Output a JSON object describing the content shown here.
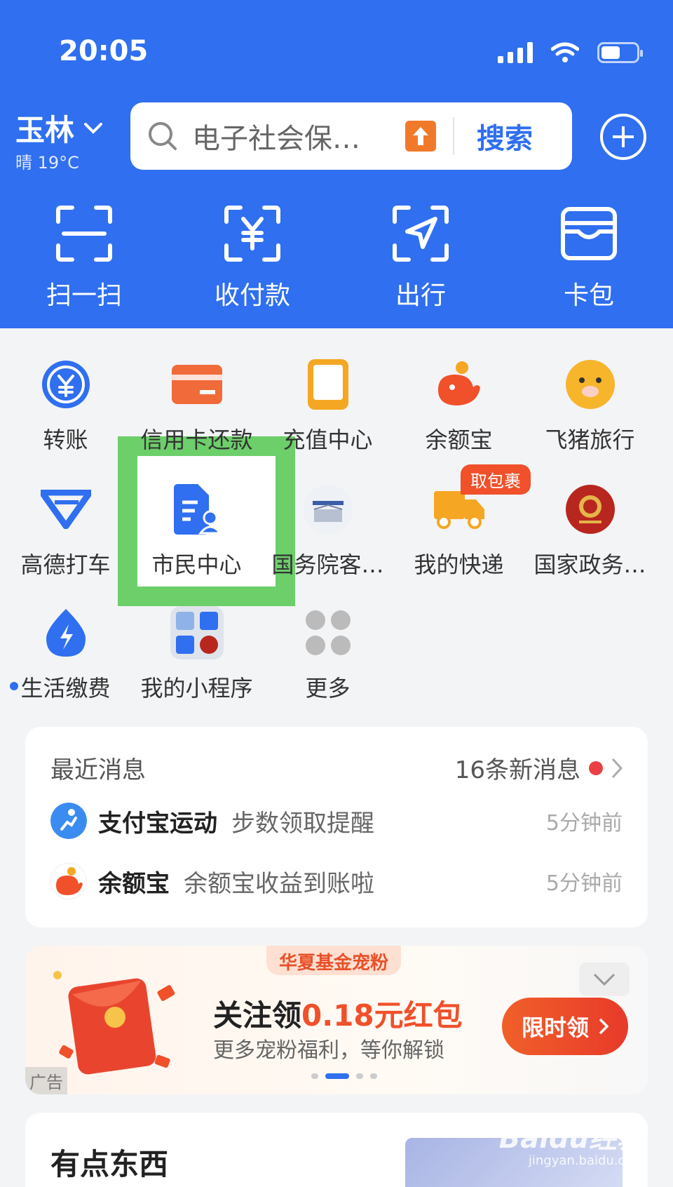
{
  "status_bar": {
    "time": "20:05"
  },
  "header": {
    "city": "玉林",
    "weather": "晴 19°C",
    "search_placeholder": "电子社会保…",
    "search_button": "搜索",
    "bg_color": "#2f6ff0"
  },
  "topbar": [
    {
      "label": "扫一扫",
      "icon": "scan-icon"
    },
    {
      "label": "收付款",
      "icon": "yuan-payment-icon"
    },
    {
      "label": "出行",
      "icon": "navigation-icon"
    },
    {
      "label": "卡包",
      "icon": "card-wallet-icon"
    }
  ],
  "grid": {
    "row1": [
      {
        "label": "转账",
        "icon": "transfer-icon"
      },
      {
        "label": "信用卡还款",
        "icon": "credit-card-icon"
      },
      {
        "label": "充值中心",
        "icon": "phone-recharge-icon"
      },
      {
        "label": "余额宝",
        "icon": "yuebao-icon"
      },
      {
        "label": "飞猪旅行",
        "icon": "fliggy-icon"
      }
    ],
    "row2": [
      {
        "label": "高德打车",
        "icon": "amap-taxi-icon"
      },
      {
        "label": "市民中心",
        "icon": "citizen-center-icon"
      },
      {
        "label": "国务院客…",
        "icon": "state-council-icon"
      },
      {
        "label": "我的快递",
        "icon": "delivery-truck-icon",
        "tag": "取包裹"
      },
      {
        "label": "国家政务…",
        "icon": "gov-service-icon"
      }
    ],
    "row3": [
      {
        "label": "生活缴费",
        "icon": "utility-bill-icon"
      },
      {
        "label": "我的小程序",
        "icon": "mini-programs-icon"
      },
      {
        "label": "更多",
        "icon": "more-icon"
      }
    ]
  },
  "messages": {
    "title": "最近消息",
    "count": "16条新消息",
    "items": [
      {
        "app": "支付宝运动",
        "text": "步数领取提醒",
        "time": "5分钟前"
      },
      {
        "app": "余额宝",
        "text": "余额宝收益到账啦",
        "time": "5分钟前"
      }
    ]
  },
  "ad": {
    "tag": "华夏基金宠粉",
    "title_prefix": "关注领",
    "title_amount": "0.18元红包",
    "subtitle": "更多宠粉福利，等你解锁",
    "button": "限时领",
    "label": "广告"
  },
  "section": {
    "title": "有点东西"
  },
  "watermark": {
    "main": "Baidu经验",
    "sub": "jingyan.baidu.com"
  }
}
